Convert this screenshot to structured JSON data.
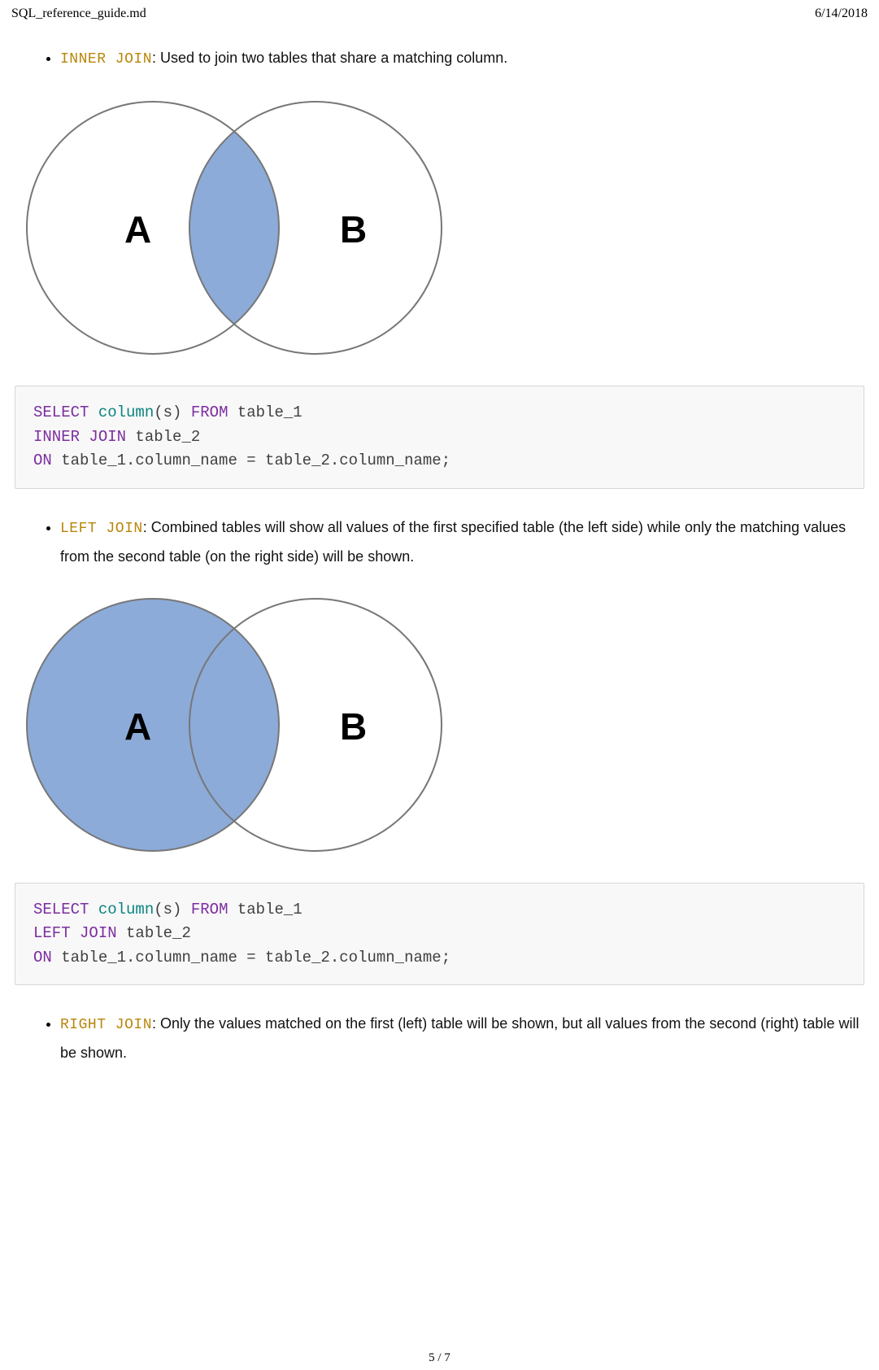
{
  "header": {
    "file_name": "SQL_reference_guide.md",
    "date": "6/14/2018"
  },
  "sections": [
    {
      "keyword": "INNER JOIN",
      "desc_prefix": ": ",
      "desc": "Used to join two tables that share a matching column.",
      "venn": {
        "label_a": "A",
        "label_b": "B",
        "fill": "intersection"
      },
      "code": {
        "l1_select": "SELECT",
        "l1_column": "column",
        "l1_sfrom": "(s) ",
        "l1_from": "FROM",
        "l1_table": " table_1",
        "l2_join": "INNER JOIN",
        "l2_table": " table_2",
        "l3_on": "ON",
        "l3_rest": " table_1.column_name = table_2.column_name;"
      }
    },
    {
      "keyword": "LEFT JOIN",
      "desc_prefix": ": ",
      "desc": "Combined tables will show all values of the first specified table (the left side) while only the matching values from the second table (on the right side) will be shown.",
      "venn": {
        "label_a": "A",
        "label_b": "B",
        "fill": "left"
      },
      "code": {
        "l1_select": "SELECT",
        "l1_column": "column",
        "l1_sfrom": "(s) ",
        "l1_from": "FROM",
        "l1_table": " table_1",
        "l2_join": "LEFT JOIN",
        "l2_table": " table_2",
        "l3_on": "ON",
        "l3_rest": " table_1.column_name = table_2.column_name;"
      }
    },
    {
      "keyword": "RIGHT JOIN",
      "desc_prefix": ": ",
      "desc": "Only the values matched on the first (left) table will be shown, but all values from the second (right) table will be shown.",
      "venn": null,
      "code": null
    }
  ],
  "footer": {
    "page_label": "5 / 7"
  },
  "colors": {
    "venn_fill": "#8cabd9",
    "venn_stroke": "#777777",
    "code_bg": "#f8f8f8",
    "code_border": "#d6d6d6",
    "kw_purple": "#7c2ea0",
    "kw_mustard": "#b8860b",
    "kw_teal": "#0a8480"
  }
}
